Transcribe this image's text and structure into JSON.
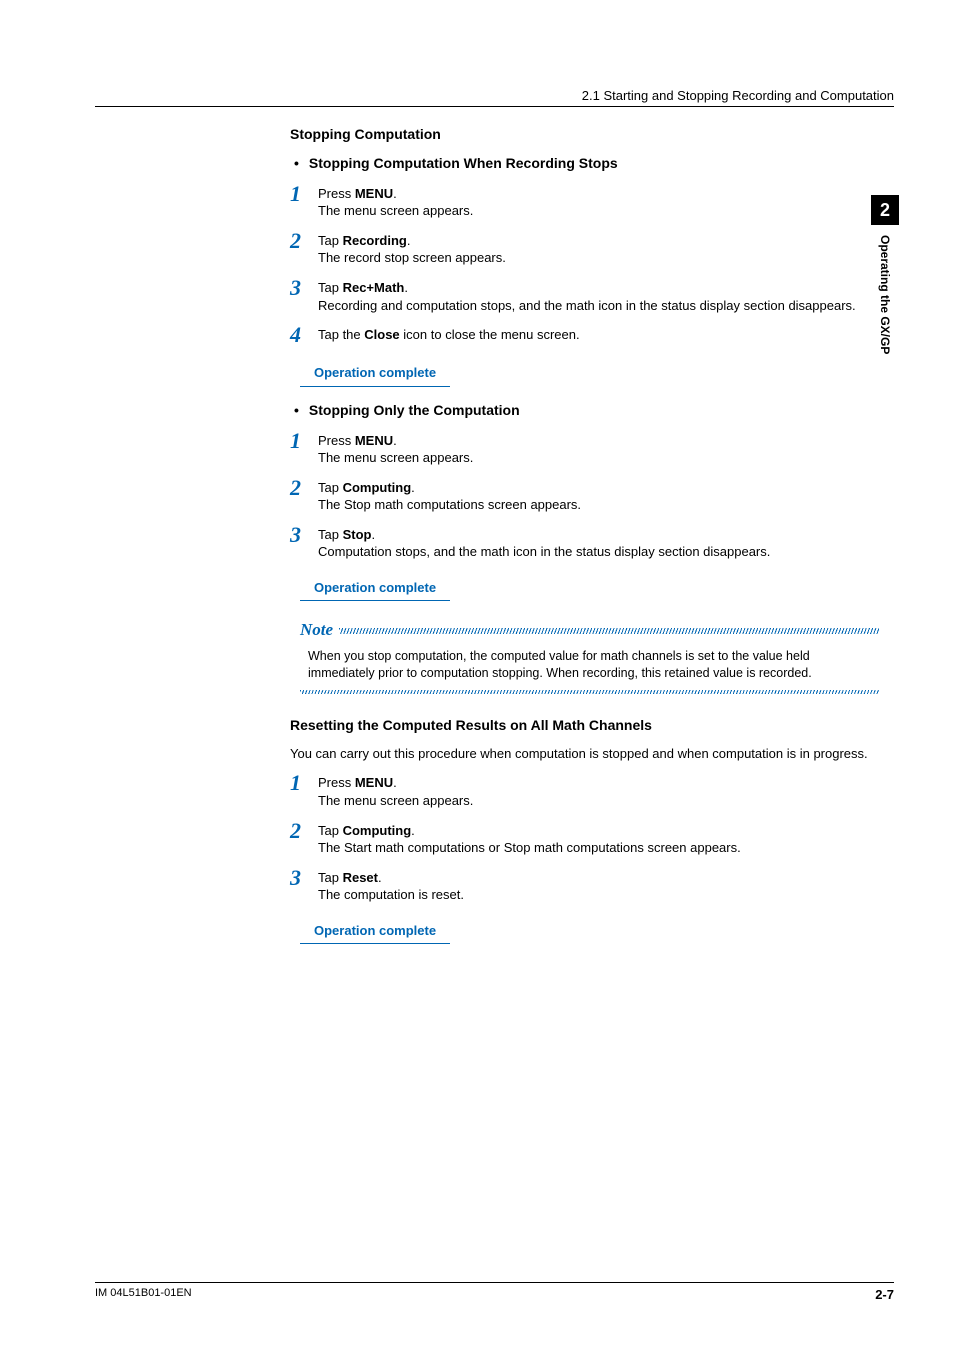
{
  "header": {
    "breadcrumb": "2.1  Starting and Stopping Recording and Computation"
  },
  "sideTab": {
    "num": "2",
    "text": "Operating the GX/GP"
  },
  "sec1": {
    "title": "Stopping Computation",
    "sub1": "Stopping Computation When Recording Stops",
    "steps1": [
      {
        "n": "1",
        "l1a": "Press ",
        "l1b": "MENU",
        "l1c": ".",
        "l2": "The menu screen appears."
      },
      {
        "n": "2",
        "l1a": "Tap ",
        "l1b": "Recording",
        "l1c": ".",
        "l2": "The record stop screen appears."
      },
      {
        "n": "3",
        "l1a": "Tap ",
        "l1b": "Rec+Math",
        "l1c": ".",
        "l2": "Recording and computation stops, and the math icon in the status display section disappears."
      },
      {
        "n": "4",
        "l1a": "Tap the ",
        "l1b": "Close",
        "l1c": " icon to close the menu screen.",
        "l2": ""
      }
    ],
    "op1": "Operation complete",
    "sub2": "Stopping Only the Computation",
    "steps2": [
      {
        "n": "1",
        "l1a": "Press ",
        "l1b": "MENU",
        "l1c": ".",
        "l2": "The menu screen appears."
      },
      {
        "n": "2",
        "l1a": "Tap ",
        "l1b": "Computing",
        "l1c": ".",
        "l2": "The Stop math computations screen appears."
      },
      {
        "n": "3",
        "l1a": "Tap ",
        "l1b": "Stop",
        "l1c": ".",
        "l2": "Computation stops, and the math icon in the status display section disappears."
      }
    ],
    "op2": "Operation complete",
    "noteLabel": "Note",
    "noteBody": "When you stop computation, the computed value for math channels is set to the value held immediately prior to computation stopping. When recording, this retained value is recorded."
  },
  "sec2": {
    "title": "Resetting the Computed Results on All Math Channels",
    "intro": "You can carry out this procedure when computation is stopped and when computation is in progress.",
    "steps": [
      {
        "n": "1",
        "l1a": "Press ",
        "l1b": "MENU",
        "l1c": ".",
        "l2": "The menu screen appears."
      },
      {
        "n": "2",
        "l1a": "Tap ",
        "l1b": "Computing",
        "l1c": ".",
        "l2": "The Start math computations or Stop math computations screen appears."
      },
      {
        "n": "3",
        "l1a": "Tap ",
        "l1b": "Reset",
        "l1c": ".",
        "l2": "The computation is reset."
      }
    ],
    "op": "Operation complete"
  },
  "footer": {
    "left": "IM 04L51B01-01EN",
    "right": "2-7"
  }
}
